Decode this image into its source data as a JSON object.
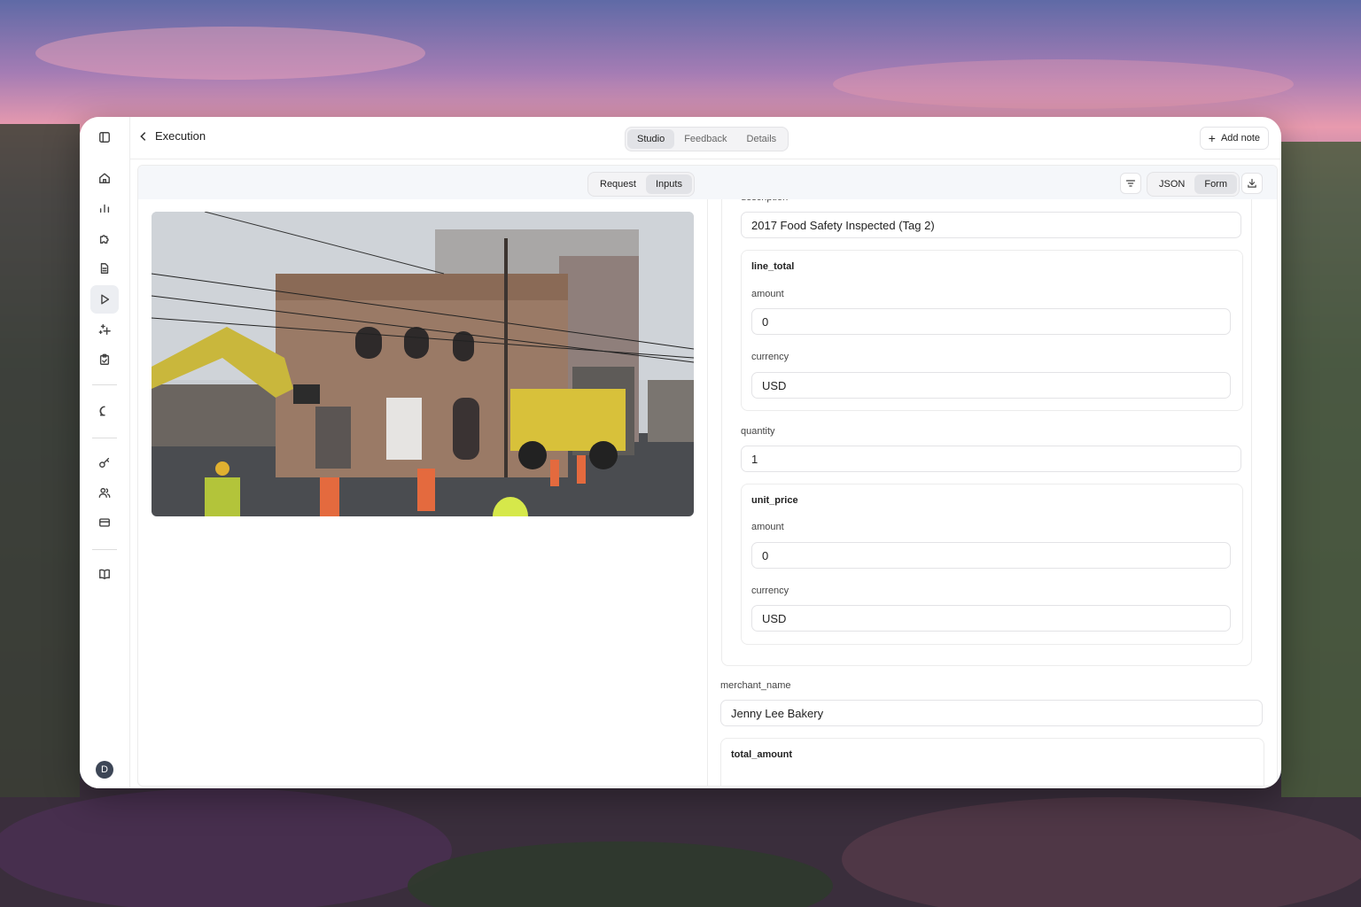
{
  "header": {
    "back_label": "Execution",
    "view_tabs": [
      "Studio",
      "Feedback",
      "Details"
    ],
    "active_view_tab": "Studio",
    "add_note_label": "Add note"
  },
  "sidebar": {
    "icons": [
      "sidebar-toggle-icon",
      "home-icon",
      "bar-chart-icon",
      "puzzle-icon",
      "document-icon",
      "play-icon",
      "sparkles-icon",
      "clipboard-check-icon",
      "chat-icon",
      "key-icon",
      "users-icon",
      "credit-card-icon",
      "book-icon"
    ],
    "active_item": "play-icon",
    "avatar_initial": "D"
  },
  "panel_tabs": {
    "items": [
      "Request",
      "Inputs"
    ],
    "active": "Inputs"
  },
  "format_tabs": {
    "items": [
      "JSON",
      "Form"
    ],
    "active": "Form"
  },
  "form": {
    "description": {
      "label": "description",
      "value": "2017 Food Safety Inspected (Tag 2)"
    },
    "line_total": {
      "label": "line_total",
      "amount_label": "amount",
      "amount": "0",
      "currency_label": "currency",
      "currency": "USD"
    },
    "quantity": {
      "label": "quantity",
      "value": "1"
    },
    "unit_price": {
      "label": "unit_price",
      "amount_label": "amount",
      "amount": "0",
      "currency_label": "currency",
      "currency": "USD"
    },
    "merchant_name": {
      "label": "merchant_name",
      "value": "Jenny Lee Bakery"
    },
    "total_amount": {
      "label": "total_amount"
    }
  },
  "colors": {
    "accent_bg": "#e2e3e7",
    "toolbar_bg": "#f5f7fa",
    "avatar_bg": "#3d4656"
  }
}
